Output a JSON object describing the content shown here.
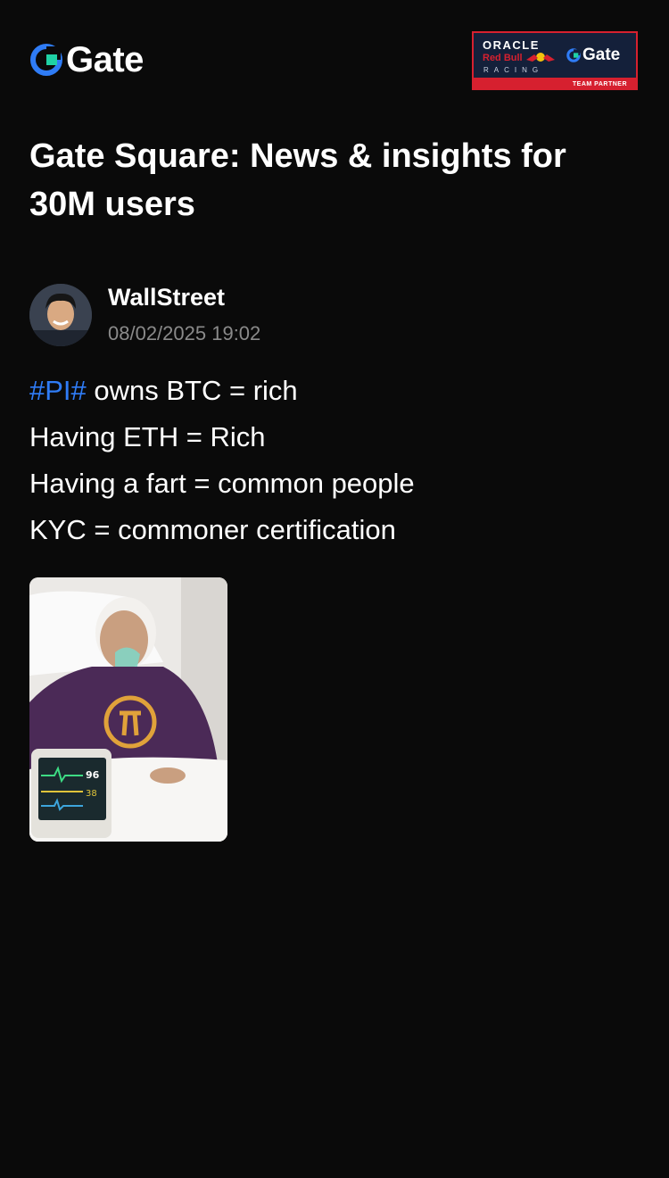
{
  "header": {
    "logo_text": "Gate",
    "partner_badge": {
      "line1": "ORACLE",
      "line2": "Red Bull",
      "line3": "RACING",
      "brand": "Gate",
      "tag": "TEAM PARTNER"
    }
  },
  "headline": "Gate Square: News & insights for 30M users",
  "post": {
    "author": "WallStreet",
    "timestamp": "08/02/2025 19:02",
    "hashtag": "#PI#",
    "lines": [
      " owns BTC = rich",
      "Having ETH = Rich",
      "Having a fart = common people",
      "KYC = commoner certification"
    ],
    "image_monitor": {
      "value1": "96",
      "value2": "38"
    }
  },
  "colors": {
    "background": "#0a0a0a",
    "brand_blue": "#2f7cf6",
    "brand_green": "#1fd1a5",
    "badge_navy": "#14203a",
    "badge_red": "#d6202f",
    "muted_text": "#8a8a8a"
  }
}
